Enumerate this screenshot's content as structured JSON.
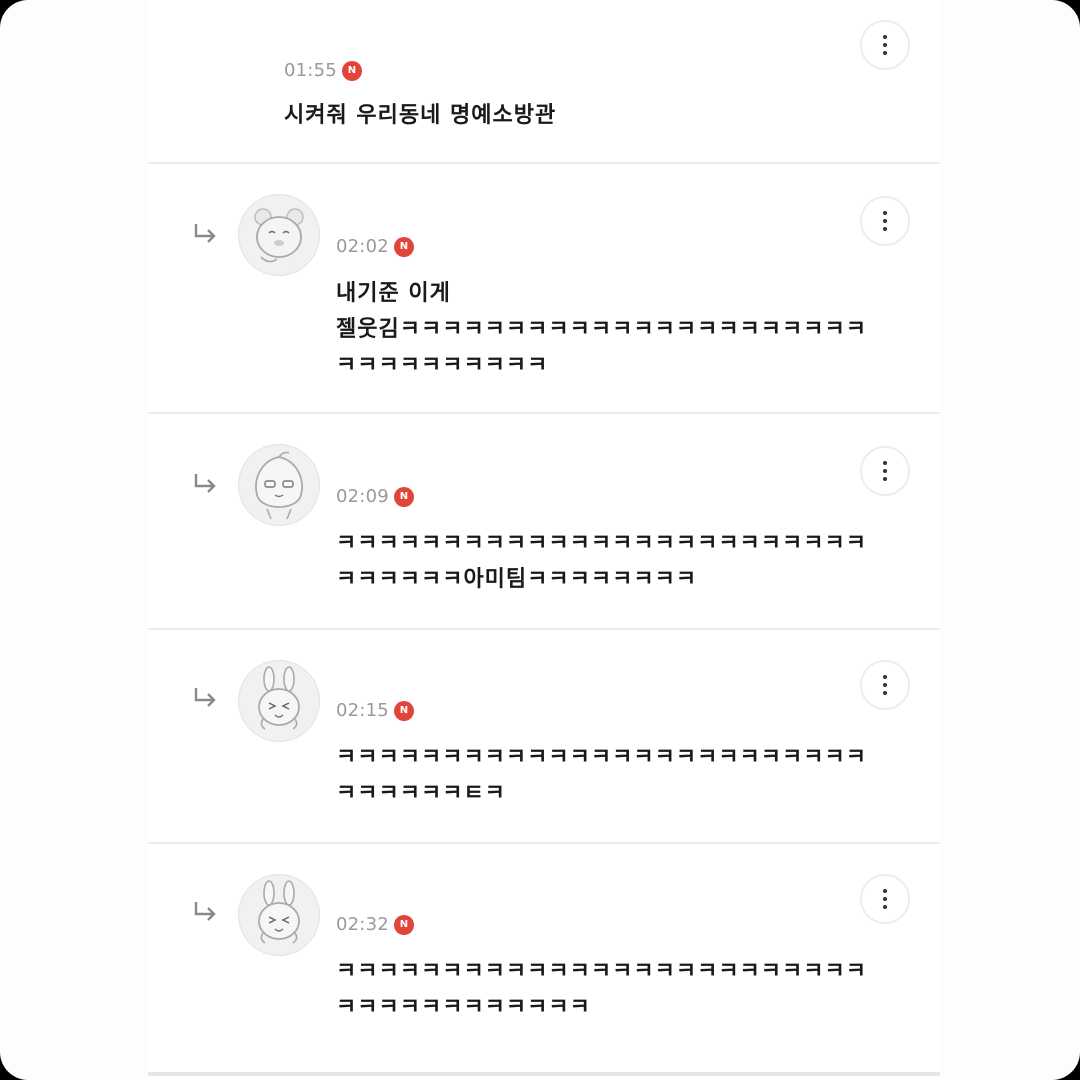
{
  "comments": [
    {
      "time": "01:55",
      "badge": "N",
      "lines": [
        "시켜줘 우리동네 명예소방관"
      ]
    },
    {
      "time": "02:02",
      "badge": "N",
      "avatar_icon": "bear-character-avatar-icon",
      "lines": [
        "내기준 이게",
        "젤웃김ㅋㅋㅋㅋㅋㅋㅋㅋㅋㅋㅋㅋㅋㅋㅋㅋㅋㅋㅋㅋㅋㅋ",
        "ㅋㅋㅋㅋㅋㅋㅋㅋㅋㅋ"
      ]
    },
    {
      "time": "02:09",
      "badge": "N",
      "avatar_icon": "peach-character-avatar-icon",
      "lines": [
        "ㅋㅋㅋㅋㅋㅋㅋㅋㅋㅋㅋㅋㅋㅋㅋㅋㅋㅋㅋㅋㅋㅋㅋㅋㅋ",
        "ㅋㅋㅋㅋㅋㅋ아미팀ㅋㅋㅋㅋㅋㅋㅋㅋ"
      ]
    },
    {
      "time": "02:15",
      "badge": "N",
      "avatar_icon": "rabbit-character-avatar-icon",
      "lines": [
        "ㅋㅋㅋㅋㅋㅋㅋㅋㅋㅋㅋㅋㅋㅋㅋㅋㅋㅋㅋㅋㅋㅋㅋㅋㅋ",
        "ㅋㅋㅋㅋㅋㅋㅌㅋ"
      ]
    },
    {
      "time": "02:32",
      "badge": "N",
      "avatar_icon": "rabbit-character-avatar-icon",
      "lines": [
        "ㅋㅋㅋㅋㅋㅋㅋㅋㅋㅋㅋㅋㅋㅋㅋㅋㅋㅋㅋㅋㅋㅋㅋㅋㅋ",
        "ㅋㅋㅋㅋㅋㅋㅋㅋㅋㅋㅋㅋ"
      ]
    }
  ],
  "colors": {
    "new_badge": "#e0453a",
    "time_text": "#9a9a9a",
    "body_text": "#1a1a1a",
    "divider": "#ececec"
  }
}
